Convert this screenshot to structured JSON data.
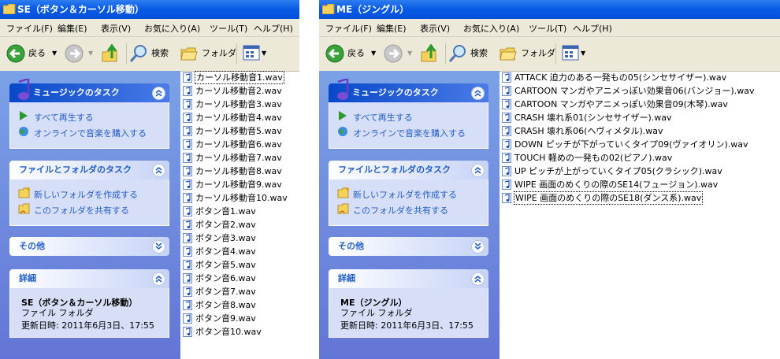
{
  "windows": [
    {
      "title": "SE（ボタン＆カーソル移動）",
      "menu": [
        "ファイル(F)",
        "編集(E)",
        "表示(V)",
        "お気に入り(A)",
        "ツール(T)",
        "ヘルプ(H)"
      ],
      "toolbar": {
        "back": "戻る",
        "search": "検索",
        "folders": "フォルダ"
      },
      "music_tasks": {
        "title": "ミュージックのタスク",
        "items": [
          "すべて再生する",
          "オンラインで音楽を購入する"
        ]
      },
      "file_tasks": {
        "title": "ファイルとフォルダのタスク",
        "items": [
          "新しいフォルダを作成する",
          "このフォルダを共有する"
        ]
      },
      "other": {
        "title": "その他"
      },
      "details": {
        "title": "詳細",
        "name": "SE（ボタン＆カーソル移動）",
        "type": "ファイル フォルダ",
        "modified": "更新日時: 2011年6月3日、17:55"
      },
      "files": [
        "カーソル移動音1.wav",
        "カーソル移動音2.wav",
        "カーソル移動音3.wav",
        "カーソル移動音4.wav",
        "カーソル移動音5.wav",
        "カーソル移動音6.wav",
        "カーソル移動音7.wav",
        "カーソル移動音8.wav",
        "カーソル移動音9.wav",
        "カーソル移動音10.wav",
        "ボタン音1.wav",
        "ボタン音2.wav",
        "ボタン音3.wav",
        "ボタン音4.wav",
        "ボタン音5.wav",
        "ボタン音6.wav",
        "ボタン音7.wav",
        "ボタン音8.wav",
        "ボタン音9.wav",
        "ボタン音10.wav"
      ]
    },
    {
      "title": "ME（ジングル）",
      "menu": [
        "ファイル(F)",
        "編集(E)",
        "表示(V)",
        "お気に入り(A)",
        "ツール(T)",
        "ヘルプ(H)"
      ],
      "toolbar": {
        "back": "戻る",
        "search": "検索",
        "folders": "フォルダ"
      },
      "music_tasks": {
        "title": "ミュージックのタスク",
        "items": [
          "すべて再生する",
          "オンラインで音楽を購入する"
        ]
      },
      "file_tasks": {
        "title": "ファイルとフォルダのタスク",
        "items": [
          "新しいフォルダを作成する",
          "このフォルダを共有する"
        ]
      },
      "other": {
        "title": "その他"
      },
      "details": {
        "title": "詳細",
        "name": "ME（ジングル）",
        "type": "ファイル フォルダ",
        "modified": "更新日時: 2011年6月3日、17:55"
      },
      "files": [
        "ATTACK 迫力のある一発もの05(シンセサイザー).wav",
        "CARTOON マンガやアニメっぽい効果音06(バンジョー).wav",
        "CARTOON マンガやアニメっぽい効果音09(木琴).wav",
        "CRASH 壊れ系01(シンセサイザー).wav",
        "CRASH 壊れ系06(ヘヴィメタル).wav",
        "DOWN ピッチが下がっていくタイプ09(ヴァイオリン).wav",
        "TOUCH 軽めの一発もの02(ピアノ).wav",
        "UP ピッチが上がっていくタイプ05(クラシック).wav",
        "WIPE 画面のめくりの際のSE14(フュージョン).wav",
        "WIPE 画面のめくりの際のSE18(ダンス系).wav"
      ]
    }
  ],
  "colors": {
    "titlebar": "#0a5ce6",
    "taskpane": "#6375d6",
    "panel_body": "#d6dff7",
    "link": "#215dc6"
  },
  "icons": [
    "folder-icon",
    "back-arrow-icon",
    "forward-arrow-icon",
    "up-folder-icon",
    "search-icon",
    "folders-icon",
    "view-grid-icon",
    "music-note-icon",
    "play-icon",
    "globe-icon",
    "new-folder-icon",
    "share-folder-icon",
    "chevron-up-icon",
    "chevron-down-icon",
    "audio-file-icon"
  ]
}
